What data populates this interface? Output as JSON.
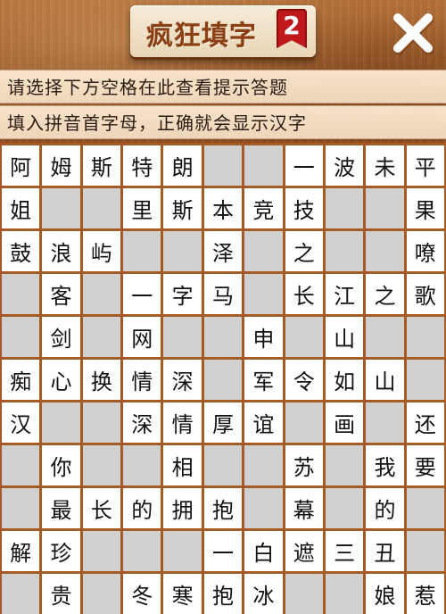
{
  "header": {
    "title": "疯狂填字",
    "level": "2",
    "close_icon": "close-icon",
    "colors": {
      "accent": "#c0191b",
      "title": "#8b3f12",
      "wood": "#a15f2c"
    }
  },
  "hints": {
    "line1": "请选择下方空格在此查看提示答题",
    "line2": "填入拼音首字母，正确就会显示汉字"
  },
  "grid": {
    "rows": [
      [
        "阿",
        "姆",
        "斯",
        "特",
        "朗",
        "",
        "",
        "一",
        "波",
        "未",
        "平"
      ],
      [
        "姐",
        "",
        "",
        "里",
        "斯",
        "本",
        "竞",
        "技",
        "",
        "",
        "果"
      ],
      [
        "鼓",
        "浪",
        "屿",
        "",
        "",
        "泽",
        "",
        "之",
        "",
        "",
        "嘹"
      ],
      [
        "",
        "客",
        "",
        "一",
        "字",
        "马",
        "",
        "长",
        "江",
        "之",
        "歌"
      ],
      [
        "",
        "剑",
        "",
        "网",
        "",
        "",
        "申",
        "",
        "山",
        "",
        ""
      ],
      [
        "痴",
        "心",
        "换",
        "情",
        "深",
        "",
        "军",
        "令",
        "如",
        "山",
        ""
      ],
      [
        "汉",
        "",
        "",
        "深",
        "情",
        "厚",
        "谊",
        "",
        "画",
        "",
        "还"
      ],
      [
        "",
        "你",
        "",
        "",
        "相",
        "",
        "",
        "苏",
        "",
        "我",
        "要"
      ],
      [
        "",
        "最",
        "长",
        "的",
        "拥",
        "抱",
        "",
        "幕",
        "",
        "的",
        ""
      ],
      [
        "解",
        "珍",
        "",
        "",
        "",
        "一",
        "白",
        "遮",
        "三",
        "丑",
        ""
      ],
      [
        "",
        "贵",
        "",
        "冬",
        "寒",
        "抱",
        "冰",
        "",
        "",
        "娘",
        "惹"
      ]
    ]
  }
}
